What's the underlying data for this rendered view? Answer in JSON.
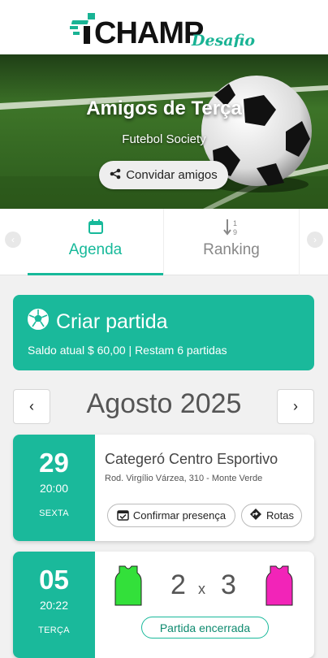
{
  "brand": {
    "name": "CHAMP",
    "tagline": "Desafio",
    "colors": {
      "accent": "#1ab99b",
      "logo_dark": "#111111",
      "logo_teal": "#19b394",
      "home_jersey": "#33e03a",
      "away_jersey": "#f224b8"
    }
  },
  "group": {
    "title": "Amigos de Terça",
    "subtitle": "Futebol Society"
  },
  "invite": {
    "label": "Convidar amigos",
    "icon": "share-icon"
  },
  "tabs": [
    {
      "label": "Agenda",
      "icon": "calendar-icon",
      "active": true
    },
    {
      "label": "Ranking",
      "icon": "sort-numeric-icon",
      "active": false
    }
  ],
  "create_match": {
    "title": "Criar partida",
    "icon": "soccer-ball-icon",
    "info": "Saldo atual $ 60,00 | Restam 6 partidas"
  },
  "calendar": {
    "month_label": "Agosto 2025",
    "prev": "‹",
    "next": "›"
  },
  "matches": [
    {
      "day": "29",
      "time": "20:00",
      "weekday": "SEXTA",
      "venue": "Categeró Centro Esportivo",
      "address": "Rod. Virgílio Várzea, 310 - Monte Verde",
      "actions": {
        "confirm": "Confirmar presença",
        "routes": "Rotas"
      }
    },
    {
      "day": "05",
      "time": "20:22",
      "weekday": "TERÇA",
      "score_home": "2",
      "separator": "x",
      "score_away": "3",
      "status": "Partida encerrada"
    }
  ]
}
